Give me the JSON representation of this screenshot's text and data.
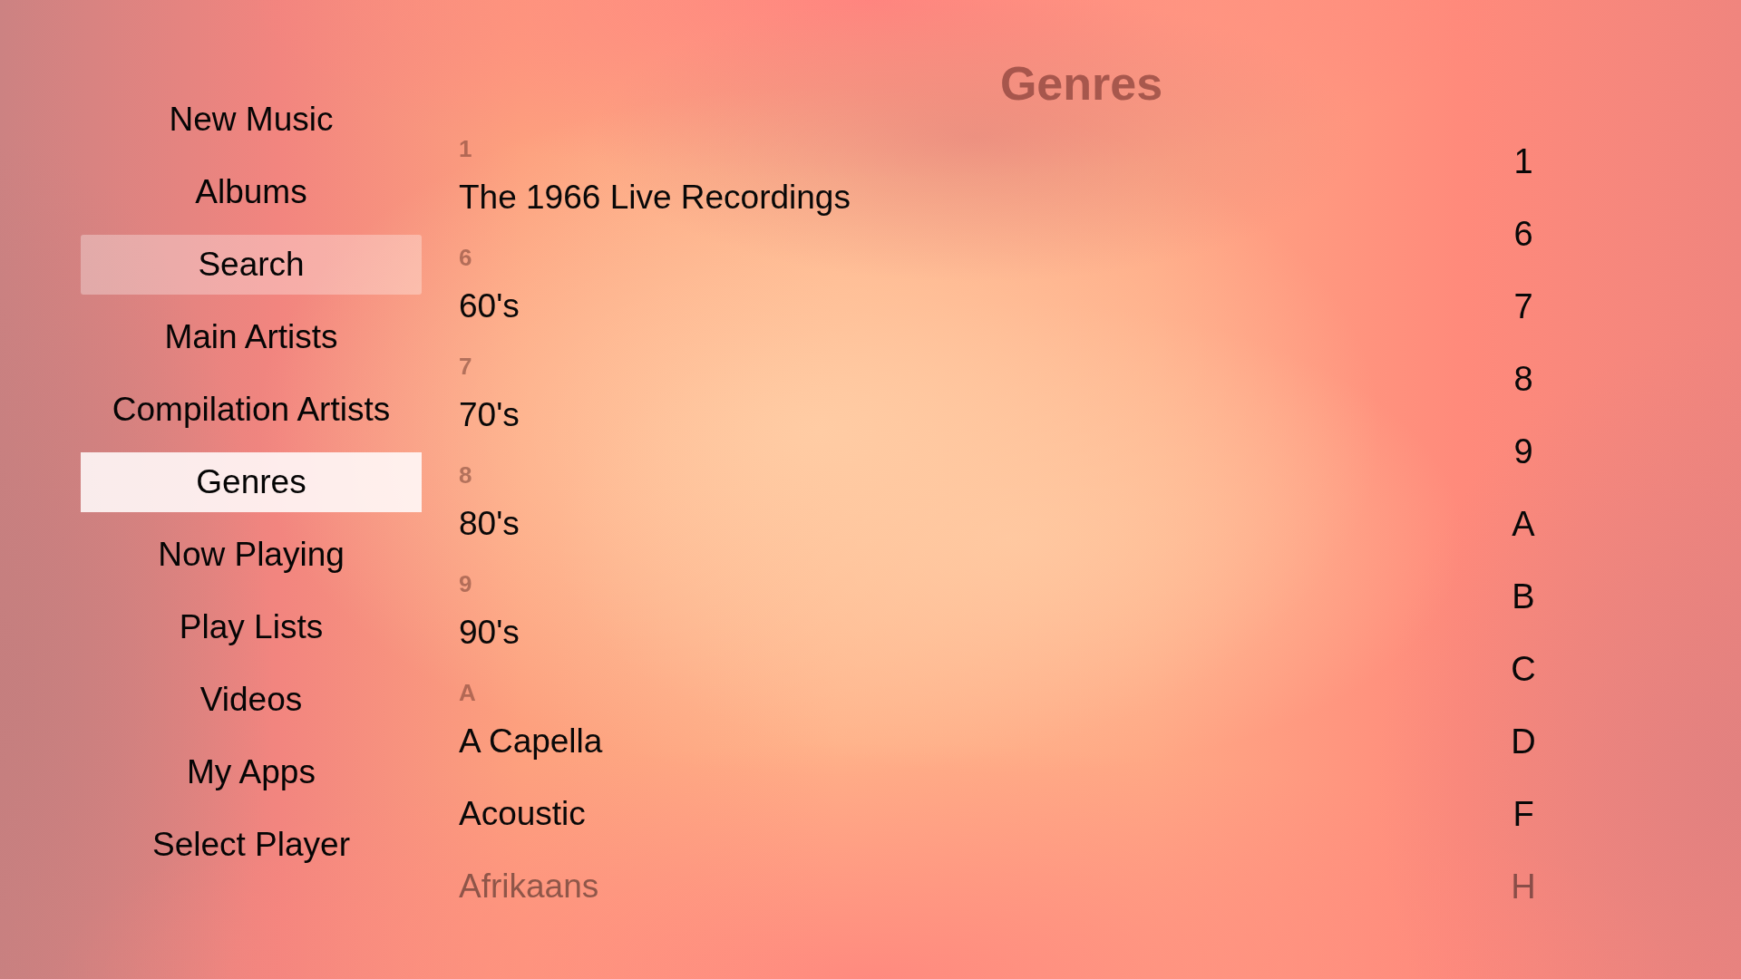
{
  "sidebar": {
    "items": [
      {
        "label": "New Music",
        "selected": false,
        "highlighted": false
      },
      {
        "label": "Albums",
        "selected": false,
        "highlighted": false
      },
      {
        "label": "Search",
        "selected": false,
        "highlighted": true
      },
      {
        "label": "Main Artists",
        "selected": false,
        "highlighted": false
      },
      {
        "label": "Compilation Artists",
        "selected": false,
        "highlighted": false
      },
      {
        "label": "Genres",
        "selected": true,
        "highlighted": false
      },
      {
        "label": "Now Playing",
        "selected": false,
        "highlighted": false
      },
      {
        "label": "Play Lists",
        "selected": false,
        "highlighted": false
      },
      {
        "label": "Videos",
        "selected": false,
        "highlighted": false
      },
      {
        "label": "My Apps",
        "selected": false,
        "highlighted": false
      },
      {
        "label": "Select Player",
        "selected": false,
        "highlighted": false
      }
    ]
  },
  "header": {
    "title": "Genres"
  },
  "genres": {
    "sections": [
      {
        "heading": "1",
        "items": [
          "The 1966 Live Recordings"
        ]
      },
      {
        "heading": "6",
        "items": [
          "60's"
        ]
      },
      {
        "heading": "7",
        "items": [
          "70's"
        ]
      },
      {
        "heading": "8",
        "items": [
          "80's"
        ]
      },
      {
        "heading": "9",
        "items": [
          "90's"
        ]
      },
      {
        "heading": "A",
        "items": [
          "A Capella",
          "Acoustic",
          "Afrikaans"
        ]
      }
    ]
  },
  "index": {
    "letters": [
      "1",
      "6",
      "7",
      "8",
      "9",
      "A",
      "B",
      "C",
      "D",
      "F",
      "H"
    ]
  }
}
